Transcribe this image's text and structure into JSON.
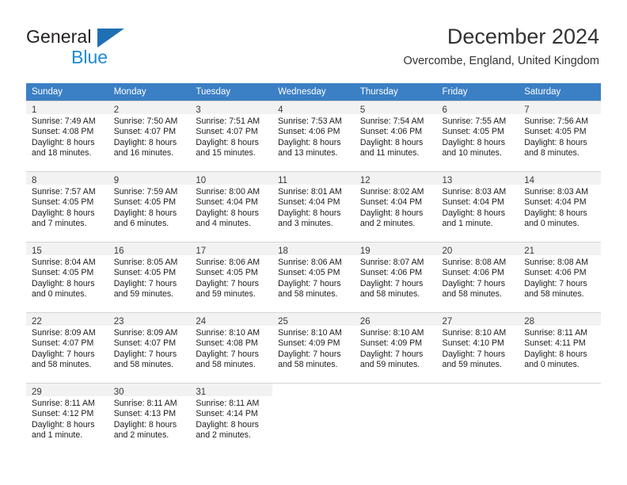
{
  "logo": {
    "text_top": "General",
    "text_bottom": "Blue",
    "triangle_color": "#1f6fb5",
    "blue_color": "#1f8ad6"
  },
  "header": {
    "title": "December 2024",
    "subtitle": "Overcombe, England, United Kingdom"
  },
  "theme": {
    "header_row_bg": "#3b7fc4",
    "header_row_text": "#ffffff",
    "daynum_bg": "#f2f2f2",
    "grid_line": "#d5d5d5"
  },
  "weekdays": [
    "Sunday",
    "Monday",
    "Tuesday",
    "Wednesday",
    "Thursday",
    "Friday",
    "Saturday"
  ],
  "weeks": [
    [
      {
        "day": "1",
        "sunrise": "Sunrise: 7:49 AM",
        "sunset": "Sunset: 4:08 PM",
        "daylight1": "Daylight: 8 hours",
        "daylight2": "and 18 minutes."
      },
      {
        "day": "2",
        "sunrise": "Sunrise: 7:50 AM",
        "sunset": "Sunset: 4:07 PM",
        "daylight1": "Daylight: 8 hours",
        "daylight2": "and 16 minutes."
      },
      {
        "day": "3",
        "sunrise": "Sunrise: 7:51 AM",
        "sunset": "Sunset: 4:07 PM",
        "daylight1": "Daylight: 8 hours",
        "daylight2": "and 15 minutes."
      },
      {
        "day": "4",
        "sunrise": "Sunrise: 7:53 AM",
        "sunset": "Sunset: 4:06 PM",
        "daylight1": "Daylight: 8 hours",
        "daylight2": "and 13 minutes."
      },
      {
        "day": "5",
        "sunrise": "Sunrise: 7:54 AM",
        "sunset": "Sunset: 4:06 PM",
        "daylight1": "Daylight: 8 hours",
        "daylight2": "and 11 minutes."
      },
      {
        "day": "6",
        "sunrise": "Sunrise: 7:55 AM",
        "sunset": "Sunset: 4:05 PM",
        "daylight1": "Daylight: 8 hours",
        "daylight2": "and 10 minutes."
      },
      {
        "day": "7",
        "sunrise": "Sunrise: 7:56 AM",
        "sunset": "Sunset: 4:05 PM",
        "daylight1": "Daylight: 8 hours",
        "daylight2": "and 8 minutes."
      }
    ],
    [
      {
        "day": "8",
        "sunrise": "Sunrise: 7:57 AM",
        "sunset": "Sunset: 4:05 PM",
        "daylight1": "Daylight: 8 hours",
        "daylight2": "and 7 minutes."
      },
      {
        "day": "9",
        "sunrise": "Sunrise: 7:59 AM",
        "sunset": "Sunset: 4:05 PM",
        "daylight1": "Daylight: 8 hours",
        "daylight2": "and 6 minutes."
      },
      {
        "day": "10",
        "sunrise": "Sunrise: 8:00 AM",
        "sunset": "Sunset: 4:04 PM",
        "daylight1": "Daylight: 8 hours",
        "daylight2": "and 4 minutes."
      },
      {
        "day": "11",
        "sunrise": "Sunrise: 8:01 AM",
        "sunset": "Sunset: 4:04 PM",
        "daylight1": "Daylight: 8 hours",
        "daylight2": "and 3 minutes."
      },
      {
        "day": "12",
        "sunrise": "Sunrise: 8:02 AM",
        "sunset": "Sunset: 4:04 PM",
        "daylight1": "Daylight: 8 hours",
        "daylight2": "and 2 minutes."
      },
      {
        "day": "13",
        "sunrise": "Sunrise: 8:03 AM",
        "sunset": "Sunset: 4:04 PM",
        "daylight1": "Daylight: 8 hours",
        "daylight2": "and 1 minute."
      },
      {
        "day": "14",
        "sunrise": "Sunrise: 8:03 AM",
        "sunset": "Sunset: 4:04 PM",
        "daylight1": "Daylight: 8 hours",
        "daylight2": "and 0 minutes."
      }
    ],
    [
      {
        "day": "15",
        "sunrise": "Sunrise: 8:04 AM",
        "sunset": "Sunset: 4:05 PM",
        "daylight1": "Daylight: 8 hours",
        "daylight2": "and 0 minutes."
      },
      {
        "day": "16",
        "sunrise": "Sunrise: 8:05 AM",
        "sunset": "Sunset: 4:05 PM",
        "daylight1": "Daylight: 7 hours",
        "daylight2": "and 59 minutes."
      },
      {
        "day": "17",
        "sunrise": "Sunrise: 8:06 AM",
        "sunset": "Sunset: 4:05 PM",
        "daylight1": "Daylight: 7 hours",
        "daylight2": "and 59 minutes."
      },
      {
        "day": "18",
        "sunrise": "Sunrise: 8:06 AM",
        "sunset": "Sunset: 4:05 PM",
        "daylight1": "Daylight: 7 hours",
        "daylight2": "and 58 minutes."
      },
      {
        "day": "19",
        "sunrise": "Sunrise: 8:07 AM",
        "sunset": "Sunset: 4:06 PM",
        "daylight1": "Daylight: 7 hours",
        "daylight2": "and 58 minutes."
      },
      {
        "day": "20",
        "sunrise": "Sunrise: 8:08 AM",
        "sunset": "Sunset: 4:06 PM",
        "daylight1": "Daylight: 7 hours",
        "daylight2": "and 58 minutes."
      },
      {
        "day": "21",
        "sunrise": "Sunrise: 8:08 AM",
        "sunset": "Sunset: 4:06 PM",
        "daylight1": "Daylight: 7 hours",
        "daylight2": "and 58 minutes."
      }
    ],
    [
      {
        "day": "22",
        "sunrise": "Sunrise: 8:09 AM",
        "sunset": "Sunset: 4:07 PM",
        "daylight1": "Daylight: 7 hours",
        "daylight2": "and 58 minutes."
      },
      {
        "day": "23",
        "sunrise": "Sunrise: 8:09 AM",
        "sunset": "Sunset: 4:07 PM",
        "daylight1": "Daylight: 7 hours",
        "daylight2": "and 58 minutes."
      },
      {
        "day": "24",
        "sunrise": "Sunrise: 8:10 AM",
        "sunset": "Sunset: 4:08 PM",
        "daylight1": "Daylight: 7 hours",
        "daylight2": "and 58 minutes."
      },
      {
        "day": "25",
        "sunrise": "Sunrise: 8:10 AM",
        "sunset": "Sunset: 4:09 PM",
        "daylight1": "Daylight: 7 hours",
        "daylight2": "and 58 minutes."
      },
      {
        "day": "26",
        "sunrise": "Sunrise: 8:10 AM",
        "sunset": "Sunset: 4:09 PM",
        "daylight1": "Daylight: 7 hours",
        "daylight2": "and 59 minutes."
      },
      {
        "day": "27",
        "sunrise": "Sunrise: 8:10 AM",
        "sunset": "Sunset: 4:10 PM",
        "daylight1": "Daylight: 7 hours",
        "daylight2": "and 59 minutes."
      },
      {
        "day": "28",
        "sunrise": "Sunrise: 8:11 AM",
        "sunset": "Sunset: 4:11 PM",
        "daylight1": "Daylight: 8 hours",
        "daylight2": "and 0 minutes."
      }
    ],
    [
      {
        "day": "29",
        "sunrise": "Sunrise: 8:11 AM",
        "sunset": "Sunset: 4:12 PM",
        "daylight1": "Daylight: 8 hours",
        "daylight2": "and 1 minute."
      },
      {
        "day": "30",
        "sunrise": "Sunrise: 8:11 AM",
        "sunset": "Sunset: 4:13 PM",
        "daylight1": "Daylight: 8 hours",
        "daylight2": "and 2 minutes."
      },
      {
        "day": "31",
        "sunrise": "Sunrise: 8:11 AM",
        "sunset": "Sunset: 4:14 PM",
        "daylight1": "Daylight: 8 hours",
        "daylight2": "and 2 minutes."
      },
      {
        "day": "",
        "sunrise": "",
        "sunset": "",
        "daylight1": "",
        "daylight2": ""
      },
      {
        "day": "",
        "sunrise": "",
        "sunset": "",
        "daylight1": "",
        "daylight2": ""
      },
      {
        "day": "",
        "sunrise": "",
        "sunset": "",
        "daylight1": "",
        "daylight2": ""
      },
      {
        "day": "",
        "sunrise": "",
        "sunset": "",
        "daylight1": "",
        "daylight2": ""
      }
    ]
  ]
}
